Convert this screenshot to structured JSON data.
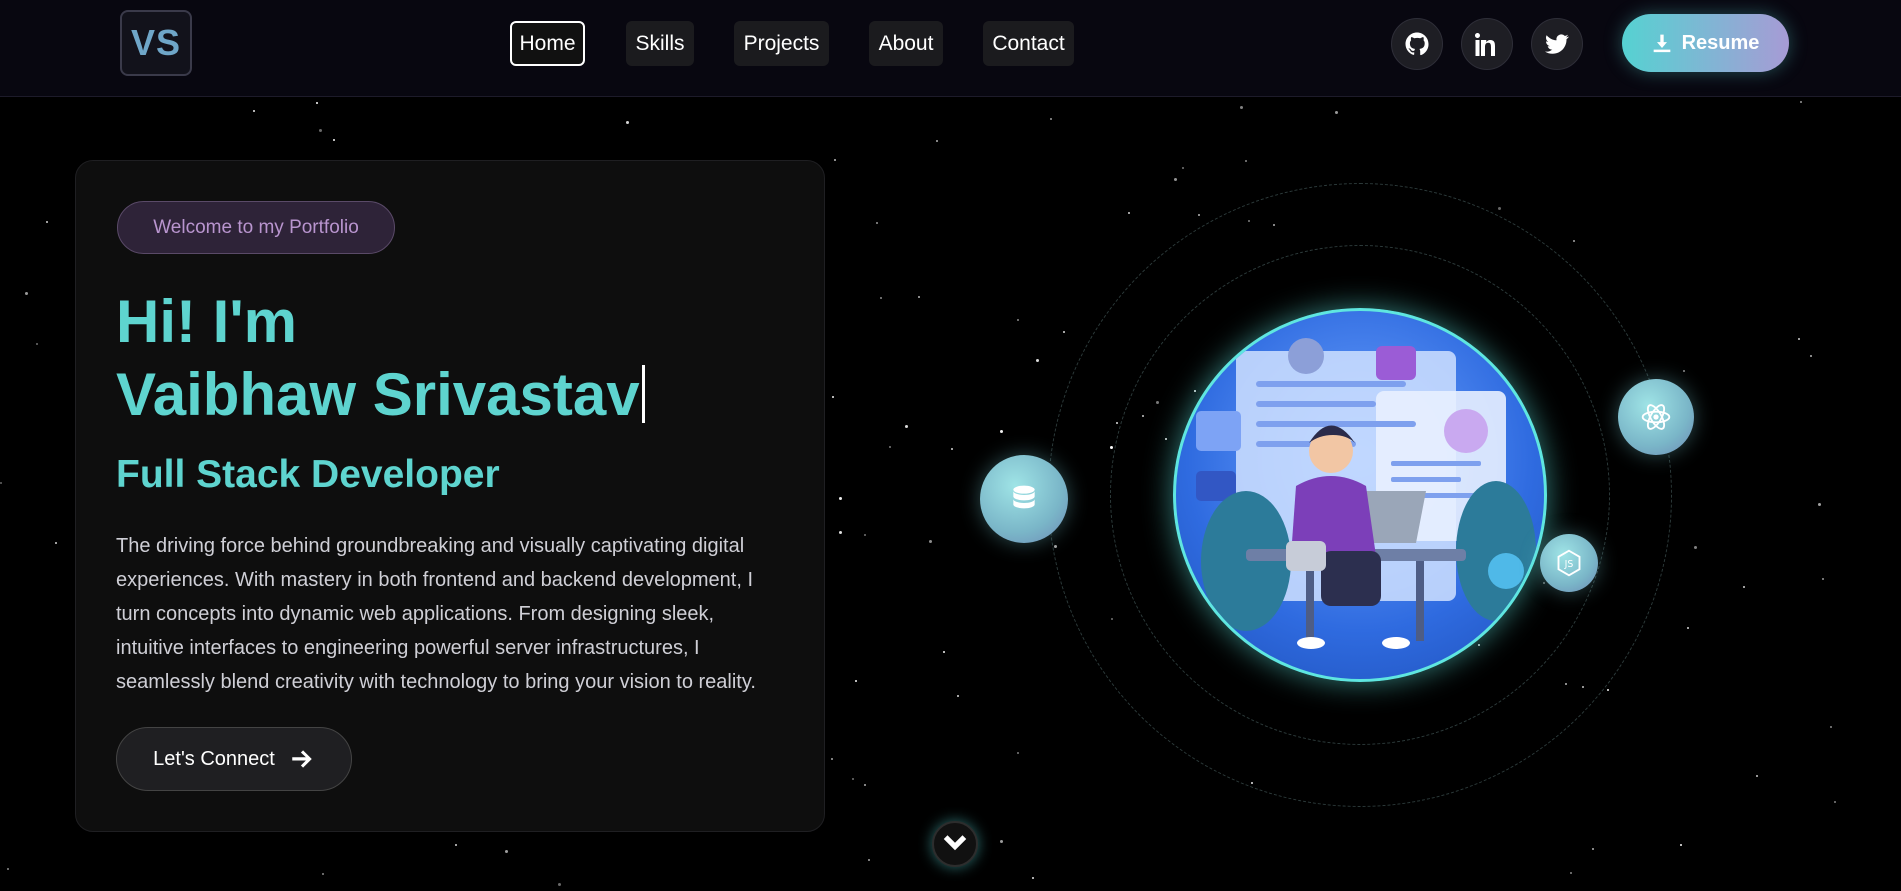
{
  "nav": {
    "logo": "VS",
    "links": [
      "Home",
      "Skills",
      "Projects",
      "About",
      "Contact"
    ],
    "active": "Home",
    "socials": [
      "github-icon",
      "linkedin-icon",
      "twitter-icon"
    ],
    "resume_label": "Resume"
  },
  "hero": {
    "badge": "Welcome to my Portfolio",
    "greeting": "Hi! I'm",
    "name": "Vaibhaw Srivastav",
    "role": "Full Stack Developer",
    "description": "The driving force behind groundbreaking and visually captivating digital experiences. With mastery in both frontend and backend development, I turn concepts into dynamic web applications. From designing sleek, intuitive interfaces to engineering powerful server infrastructures, I seamlessly blend creativity with technology to bring your vision to reality.",
    "cta_label": "Let's Connect"
  },
  "colors": {
    "accent": "#5ed4cf",
    "badge_text": "#b995cf",
    "resume_gradient_start": "#55d2d2",
    "resume_gradient_end": "#a79bd5"
  },
  "orbit_icons": [
    "database-icon",
    "react-icon",
    "nodejs-icon"
  ]
}
